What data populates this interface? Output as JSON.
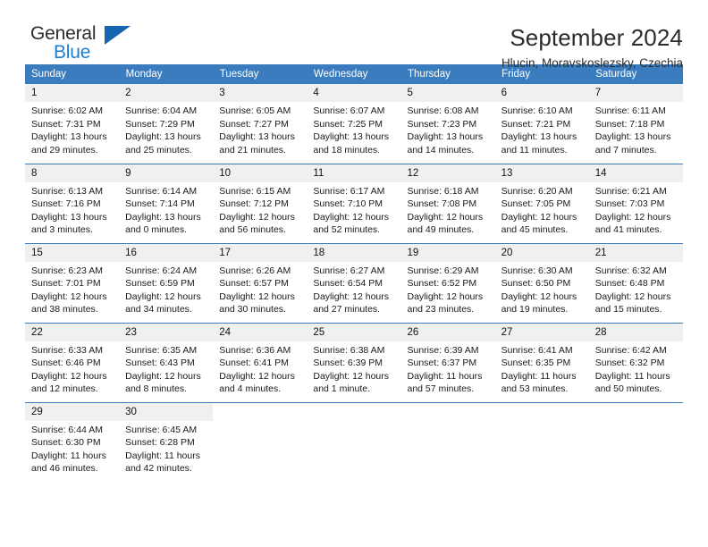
{
  "brand": {
    "line1": "General",
    "line2": "Blue",
    "triangle_color": "#1565b0",
    "blue_color": "#1b7fd4"
  },
  "header": {
    "title": "September 2024",
    "subtitle": "Hlucin, Moravskoslezsky, Czechia"
  },
  "theme": {
    "header_blue": "#3b7cbf",
    "daynum_gray": "#f0f0f0"
  },
  "weekday_headers": [
    "Sunday",
    "Monday",
    "Tuesday",
    "Wednesday",
    "Thursday",
    "Friday",
    "Saturday"
  ],
  "weeks": [
    [
      {
        "day": "1",
        "sunrise": "Sunrise: 6:02 AM",
        "sunset": "Sunset: 7:31 PM",
        "daylight": "Daylight: 13 hours and 29 minutes."
      },
      {
        "day": "2",
        "sunrise": "Sunrise: 6:04 AM",
        "sunset": "Sunset: 7:29 PM",
        "daylight": "Daylight: 13 hours and 25 minutes."
      },
      {
        "day": "3",
        "sunrise": "Sunrise: 6:05 AM",
        "sunset": "Sunset: 7:27 PM",
        "daylight": "Daylight: 13 hours and 21 minutes."
      },
      {
        "day": "4",
        "sunrise": "Sunrise: 6:07 AM",
        "sunset": "Sunset: 7:25 PM",
        "daylight": "Daylight: 13 hours and 18 minutes."
      },
      {
        "day": "5",
        "sunrise": "Sunrise: 6:08 AM",
        "sunset": "Sunset: 7:23 PM",
        "daylight": "Daylight: 13 hours and 14 minutes."
      },
      {
        "day": "6",
        "sunrise": "Sunrise: 6:10 AM",
        "sunset": "Sunset: 7:21 PM",
        "daylight": "Daylight: 13 hours and 11 minutes."
      },
      {
        "day": "7",
        "sunrise": "Sunrise: 6:11 AM",
        "sunset": "Sunset: 7:18 PM",
        "daylight": "Daylight: 13 hours and 7 minutes."
      }
    ],
    [
      {
        "day": "8",
        "sunrise": "Sunrise: 6:13 AM",
        "sunset": "Sunset: 7:16 PM",
        "daylight": "Daylight: 13 hours and 3 minutes."
      },
      {
        "day": "9",
        "sunrise": "Sunrise: 6:14 AM",
        "sunset": "Sunset: 7:14 PM",
        "daylight": "Daylight: 13 hours and 0 minutes."
      },
      {
        "day": "10",
        "sunrise": "Sunrise: 6:15 AM",
        "sunset": "Sunset: 7:12 PM",
        "daylight": "Daylight: 12 hours and 56 minutes."
      },
      {
        "day": "11",
        "sunrise": "Sunrise: 6:17 AM",
        "sunset": "Sunset: 7:10 PM",
        "daylight": "Daylight: 12 hours and 52 minutes."
      },
      {
        "day": "12",
        "sunrise": "Sunrise: 6:18 AM",
        "sunset": "Sunset: 7:08 PM",
        "daylight": "Daylight: 12 hours and 49 minutes."
      },
      {
        "day": "13",
        "sunrise": "Sunrise: 6:20 AM",
        "sunset": "Sunset: 7:05 PM",
        "daylight": "Daylight: 12 hours and 45 minutes."
      },
      {
        "day": "14",
        "sunrise": "Sunrise: 6:21 AM",
        "sunset": "Sunset: 7:03 PM",
        "daylight": "Daylight: 12 hours and 41 minutes."
      }
    ],
    [
      {
        "day": "15",
        "sunrise": "Sunrise: 6:23 AM",
        "sunset": "Sunset: 7:01 PM",
        "daylight": "Daylight: 12 hours and 38 minutes."
      },
      {
        "day": "16",
        "sunrise": "Sunrise: 6:24 AM",
        "sunset": "Sunset: 6:59 PM",
        "daylight": "Daylight: 12 hours and 34 minutes."
      },
      {
        "day": "17",
        "sunrise": "Sunrise: 6:26 AM",
        "sunset": "Sunset: 6:57 PM",
        "daylight": "Daylight: 12 hours and 30 minutes."
      },
      {
        "day": "18",
        "sunrise": "Sunrise: 6:27 AM",
        "sunset": "Sunset: 6:54 PM",
        "daylight": "Daylight: 12 hours and 27 minutes."
      },
      {
        "day": "19",
        "sunrise": "Sunrise: 6:29 AM",
        "sunset": "Sunset: 6:52 PM",
        "daylight": "Daylight: 12 hours and 23 minutes."
      },
      {
        "day": "20",
        "sunrise": "Sunrise: 6:30 AM",
        "sunset": "Sunset: 6:50 PM",
        "daylight": "Daylight: 12 hours and 19 minutes."
      },
      {
        "day": "21",
        "sunrise": "Sunrise: 6:32 AM",
        "sunset": "Sunset: 6:48 PM",
        "daylight": "Daylight: 12 hours and 15 minutes."
      }
    ],
    [
      {
        "day": "22",
        "sunrise": "Sunrise: 6:33 AM",
        "sunset": "Sunset: 6:46 PM",
        "daylight": "Daylight: 12 hours and 12 minutes."
      },
      {
        "day": "23",
        "sunrise": "Sunrise: 6:35 AM",
        "sunset": "Sunset: 6:43 PM",
        "daylight": "Daylight: 12 hours and 8 minutes."
      },
      {
        "day": "24",
        "sunrise": "Sunrise: 6:36 AM",
        "sunset": "Sunset: 6:41 PM",
        "daylight": "Daylight: 12 hours and 4 minutes."
      },
      {
        "day": "25",
        "sunrise": "Sunrise: 6:38 AM",
        "sunset": "Sunset: 6:39 PM",
        "daylight": "Daylight: 12 hours and 1 minute."
      },
      {
        "day": "26",
        "sunrise": "Sunrise: 6:39 AM",
        "sunset": "Sunset: 6:37 PM",
        "daylight": "Daylight: 11 hours and 57 minutes."
      },
      {
        "day": "27",
        "sunrise": "Sunrise: 6:41 AM",
        "sunset": "Sunset: 6:35 PM",
        "daylight": "Daylight: 11 hours and 53 minutes."
      },
      {
        "day": "28",
        "sunrise": "Sunrise: 6:42 AM",
        "sunset": "Sunset: 6:32 PM",
        "daylight": "Daylight: 11 hours and 50 minutes."
      }
    ],
    [
      {
        "day": "29",
        "sunrise": "Sunrise: 6:44 AM",
        "sunset": "Sunset: 6:30 PM",
        "daylight": "Daylight: 11 hours and 46 minutes."
      },
      {
        "day": "30",
        "sunrise": "Sunrise: 6:45 AM",
        "sunset": "Sunset: 6:28 PM",
        "daylight": "Daylight: 11 hours and 42 minutes."
      },
      {
        "day": "",
        "sunrise": "",
        "sunset": "",
        "daylight": ""
      },
      {
        "day": "",
        "sunrise": "",
        "sunset": "",
        "daylight": ""
      },
      {
        "day": "",
        "sunrise": "",
        "sunset": "",
        "daylight": ""
      },
      {
        "day": "",
        "sunrise": "",
        "sunset": "",
        "daylight": ""
      },
      {
        "day": "",
        "sunrise": "",
        "sunset": "",
        "daylight": ""
      }
    ]
  ]
}
